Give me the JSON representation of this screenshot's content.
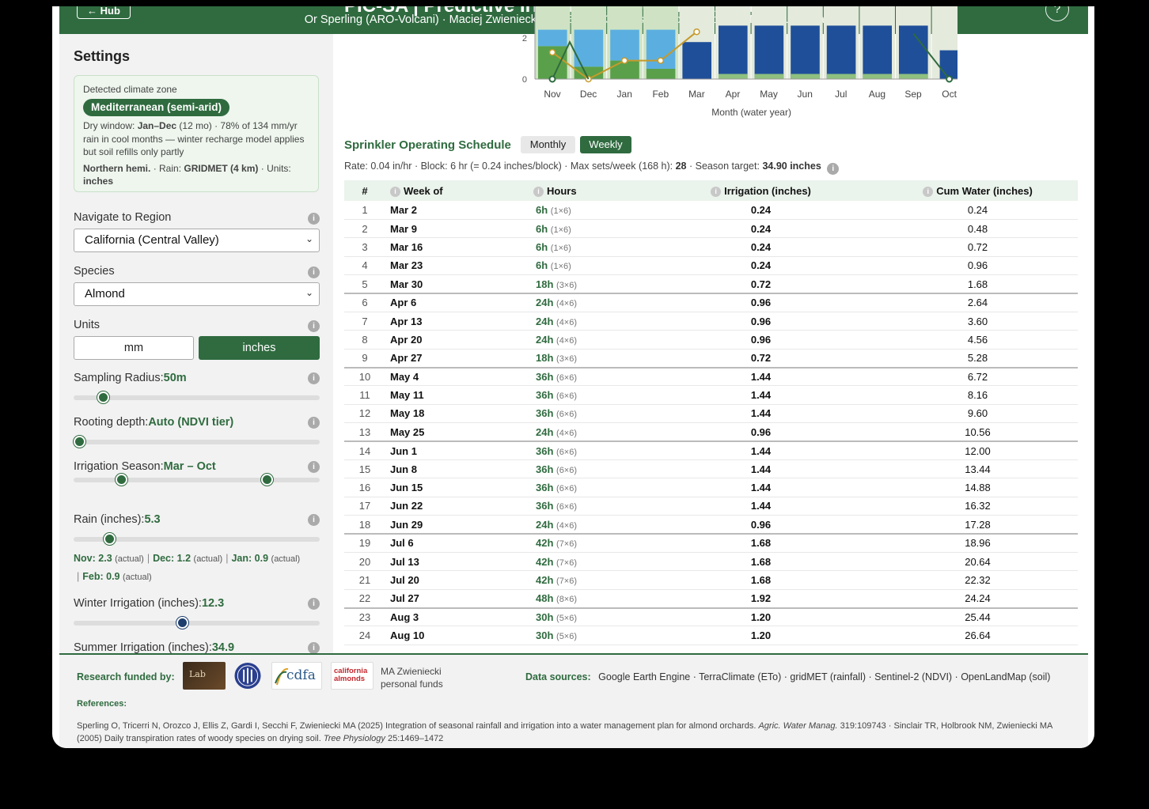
{
  "header": {
    "hub_label": "← Hub",
    "title": "PIC-SA | Predictive Irrigation Scheduling Assistant",
    "authors": "Or Sperling (ARO-Volcani) · Maciej Zwieniecki, Zac Ellis (UC Davis) · Niccolò Tricerri (UNITO-IUSS Pavia)",
    "help_label": "?"
  },
  "sidebar": {
    "title": "Settings",
    "climate": {
      "heading": "Detected climate zone",
      "zone": "Mediterranean (semi-arid)",
      "dry_window_label": "Dry window:",
      "dry_window_value": "Jan–Dec",
      "description": "(12 mo) · 78% of 134 mm/yr rain in cool months — winter recharge model applies but soil refills only partly",
      "hemisphere": "Northern hemi.",
      "rain_label": "· Rain:",
      "rain_source": "GRIDMET (4 km)",
      "units_label": "· Units:",
      "units_value": "inches"
    },
    "region": {
      "label": "Navigate to Region",
      "value": "California (Central Valley)"
    },
    "species": {
      "label": "Species",
      "value": "Almond"
    },
    "units": {
      "label": "Units",
      "option_mm": "mm",
      "option_in": "inches",
      "selected": "inches"
    },
    "sampling_radius": {
      "label": "Sampling Radius:",
      "value": "50m",
      "fraction": 0.1
    },
    "rooting_depth": {
      "label": "Rooting depth:",
      "value": "Auto (NDVI tier)",
      "fraction": 0.0
    },
    "irrigation_season": {
      "label": "Irrigation Season:",
      "value": "Mar – Oct",
      "start_fraction": 0.18,
      "end_fraction": 0.8
    },
    "rain": {
      "label": "Rain (inches):",
      "value": "5.3",
      "fraction": 0.13,
      "months": [
        {
          "month": "Nov:",
          "value": "2.3",
          "note": "(actual)"
        },
        {
          "month": "Dec:",
          "value": "1.2",
          "note": "(actual)"
        },
        {
          "month": "Jan:",
          "value": "0.9",
          "note": "(actual)"
        },
        {
          "month": "Feb:",
          "value": "0.9",
          "note": "(actual)"
        }
      ]
    },
    "winter_irrigation": {
      "label": "Winter Irrigation (inches):",
      "value": "12.3",
      "fraction": 0.44
    },
    "summer_irrigation": {
      "label": "Summer Irrigation (inches):",
      "value": "34.9"
    },
    "info_glyph": "i"
  },
  "chart_data": {
    "type": "bar",
    "categories": [
      "Nov",
      "Dec",
      "Jan",
      "Feb",
      "Mar",
      "Apr",
      "May",
      "Jun",
      "Jul",
      "Aug",
      "Sep",
      "Oct"
    ],
    "xlabel": "Month (water year)",
    "visible_y_ticks": [
      "2",
      "0"
    ],
    "visible_y_range": [
      0,
      2.3
    ],
    "colors": {
      "green_bar": "#5aa04a",
      "light_blue": "#5bafe0",
      "navy_bar": "#1f4f99",
      "dark_line": "#2f6b3f",
      "gold_line": "#c69a2a"
    },
    "green_line_values": [
      1.6,
      0.0,
      0.5,
      0.5
    ],
    "gold_line_values": [
      1.3,
      0.0,
      0.9,
      0.9,
      2.3
    ]
  },
  "schedule": {
    "title": "Sprinkler Operating Schedule",
    "tab_monthly": "Monthly",
    "tab_weekly": "Weekly",
    "active_tab": "Weekly",
    "meta_prefix": "Rate: 0.04 in/hr · Block: 6 hr (= 0.24 inches/block) · Max sets/week (168 h):",
    "meta_max_sets": "28",
    "meta_target_label": "· Season target:",
    "meta_target": "34.90 inches",
    "columns": [
      "#",
      "Week of",
      "Hours",
      "Irrigation (inches)",
      "Cum Water (inches)"
    ],
    "rows": [
      {
        "n": "1",
        "week": "Mar 2",
        "hours": "6h",
        "blocks": "(1×6)",
        "irr": "0.24",
        "cum": "0.24",
        "mstart": false
      },
      {
        "n": "2",
        "week": "Mar 9",
        "hours": "6h",
        "blocks": "(1×6)",
        "irr": "0.24",
        "cum": "0.48",
        "mstart": false
      },
      {
        "n": "3",
        "week": "Mar 16",
        "hours": "6h",
        "blocks": "(1×6)",
        "irr": "0.24",
        "cum": "0.72",
        "mstart": false
      },
      {
        "n": "4",
        "week": "Mar 23",
        "hours": "6h",
        "blocks": "(1×6)",
        "irr": "0.24",
        "cum": "0.96",
        "mstart": false
      },
      {
        "n": "5",
        "week": "Mar 30",
        "hours": "18h",
        "blocks": "(3×6)",
        "irr": "0.72",
        "cum": "1.68",
        "mstart": false
      },
      {
        "n": "6",
        "week": "Apr 6",
        "hours": "24h",
        "blocks": "(4×6)",
        "irr": "0.96",
        "cum": "2.64",
        "mstart": true
      },
      {
        "n": "7",
        "week": "Apr 13",
        "hours": "24h",
        "blocks": "(4×6)",
        "irr": "0.96",
        "cum": "3.60",
        "mstart": false
      },
      {
        "n": "8",
        "week": "Apr 20",
        "hours": "24h",
        "blocks": "(4×6)",
        "irr": "0.96",
        "cum": "4.56",
        "mstart": false
      },
      {
        "n": "9",
        "week": "Apr 27",
        "hours": "18h",
        "blocks": "(3×6)",
        "irr": "0.72",
        "cum": "5.28",
        "mstart": false
      },
      {
        "n": "10",
        "week": "May 4",
        "hours": "36h",
        "blocks": "(6×6)",
        "irr": "1.44",
        "cum": "6.72",
        "mstart": true
      },
      {
        "n": "11",
        "week": "May 11",
        "hours": "36h",
        "blocks": "(6×6)",
        "irr": "1.44",
        "cum": "8.16",
        "mstart": false
      },
      {
        "n": "12",
        "week": "May 18",
        "hours": "36h",
        "blocks": "(6×6)",
        "irr": "1.44",
        "cum": "9.60",
        "mstart": false
      },
      {
        "n": "13",
        "week": "May 25",
        "hours": "24h",
        "blocks": "(4×6)",
        "irr": "0.96",
        "cum": "10.56",
        "mstart": false
      },
      {
        "n": "14",
        "week": "Jun 1",
        "hours": "36h",
        "blocks": "(6×6)",
        "irr": "1.44",
        "cum": "12.00",
        "mstart": true
      },
      {
        "n": "15",
        "week": "Jun 8",
        "hours": "36h",
        "blocks": "(6×6)",
        "irr": "1.44",
        "cum": "13.44",
        "mstart": false
      },
      {
        "n": "16",
        "week": "Jun 15",
        "hours": "36h",
        "blocks": "(6×6)",
        "irr": "1.44",
        "cum": "14.88",
        "mstart": false
      },
      {
        "n": "17",
        "week": "Jun 22",
        "hours": "36h",
        "blocks": "(6×6)",
        "irr": "1.44",
        "cum": "16.32",
        "mstart": false
      },
      {
        "n": "18",
        "week": "Jun 29",
        "hours": "24h",
        "blocks": "(4×6)",
        "irr": "0.96",
        "cum": "17.28",
        "mstart": false
      },
      {
        "n": "19",
        "week": "Jul 6",
        "hours": "42h",
        "blocks": "(7×6)",
        "irr": "1.68",
        "cum": "18.96",
        "mstart": true
      },
      {
        "n": "20",
        "week": "Jul 13",
        "hours": "42h",
        "blocks": "(7×6)",
        "irr": "1.68",
        "cum": "20.64",
        "mstart": false
      },
      {
        "n": "21",
        "week": "Jul 20",
        "hours": "42h",
        "blocks": "(7×6)",
        "irr": "1.68",
        "cum": "22.32",
        "mstart": false
      },
      {
        "n": "22",
        "week": "Jul 27",
        "hours": "48h",
        "blocks": "(8×6)",
        "irr": "1.92",
        "cum": "24.24",
        "mstart": false
      },
      {
        "n": "23",
        "week": "Aug 3",
        "hours": "30h",
        "blocks": "(5×6)",
        "irr": "1.20",
        "cum": "25.44",
        "mstart": true
      },
      {
        "n": "24",
        "week": "Aug 10",
        "hours": "30h",
        "blocks": "(5×6)",
        "irr": "1.20",
        "cum": "26.64",
        "mstart": false
      }
    ]
  },
  "footer": {
    "funded_label": "Research funded by:",
    "logos": [
      "Lab",
      "cdfa",
      "california almonds"
    ],
    "personal_funds": "MA Zwieniecki personal funds",
    "data_sources_label": "Data sources:",
    "data_sources": "Google Earth Engine · TerraClimate (ETo) · gridMET (rainfall) · Sentinel-2 (NDVI) · OpenLandMap (soil)",
    "references_label": "References:",
    "ref1": "Sperling O, Tricerri N, Orozco J, Ellis Z, Gardi I, Secchi F, Zwieniecki MA (2025) Integration of seasonal rainfall and irrigation into a water management plan for almond orchards.",
    "ref1_journal": "Agric. Water Manag.",
    "ref1_tail": "319:109743 ·",
    "ref2": "Sinclair TR, Holbrook NM, Zwieniecki MA (2005) Daily transpiration rates of woody species on drying soil.",
    "ref2_journal": "Tree Physiology",
    "ref2_tail": "25:1469–1472"
  }
}
